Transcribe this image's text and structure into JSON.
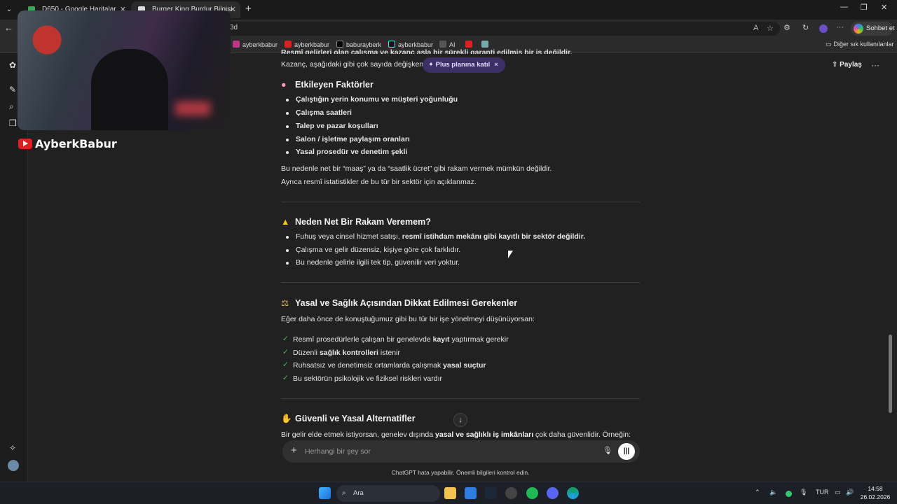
{
  "browser": {
    "tabs": [
      {
        "title": "D650 - Google Haritalar",
        "active": false
      },
      {
        "title": "Burger King Burdur Bilgisi",
        "active": true
      }
    ],
    "url_fragment": "3d",
    "sohbet_label": "Sohbet et",
    "bookmarks": [
      "ayberkbabur",
      "ayberkbabur",
      "baburayberk",
      "ayberkbabur",
      "AI"
    ],
    "other_bookmarks": "Diğer sık kullanılanlar"
  },
  "overlay": {
    "channel_name": "AyberkBabur"
  },
  "header": {
    "share_label": "Paylaş",
    "more_label": "···"
  },
  "promo": {
    "label": "Plus planına katıl",
    "close": "×"
  },
  "content": {
    "cut_top_line": "Resmî gelirleri olan çalışma ve kazanç asla bir sürekli garanti edilmiş bir iş değildir.",
    "intro_line_a": "Kazanç, aşağıdaki gibi çok sayıda değişkene",
    "section1": {
      "title": "Etkileyen Faktörler",
      "items": [
        "Çalıştığın yerin konumu ve müşteri yoğunluğu",
        "Çalışma saatleri",
        "Talep ve pazar koşulları",
        "Salon / işletme paylaşım oranları",
        "Yasal prosedür ve denetim şekli"
      ],
      "para1": "Bu nedenle net bir “maaş” ya da “saatlik ücret” gibi rakam vermek mümkün değildir.",
      "para2": "Ayrıca resmî istatistikler de bu tür bir sektör için açıklanmaz."
    },
    "section2": {
      "title": "Neden Net Bir Rakam Veremem?",
      "item1_pre": "Fuhuş veya cinsel hizmet satışı, ",
      "item1_bold": "resmî istihdam mekânı gibi kayıtlı bir sektör değildir.",
      "item2": "Çalışma ve gelir düzensiz, kişiye göre çok farklıdır.",
      "item3": "Bu nedenle gelirle ilgili tek tip, güvenilir veri yoktur."
    },
    "section3": {
      "title": "Yasal ve Sağlık Açısından Dikkat Edilmesi Gerekenler",
      "intro": "Eğer daha önce de konuştuğumuz gibi bu tür bir işe yönelmeyi düşünüyorsan:",
      "c1_pre": "Resmî prosedürlerle çalışan bir genelevde ",
      "c1_bold": "kayıt",
      "c1_post": " yaptırmak gerekir",
      "c2_pre": "Düzenli ",
      "c2_bold": "sağlık kontrolleri",
      "c2_post": " istenir",
      "c3_pre": "Ruhsatsız ve denetimsiz ortamlarda çalışmak ",
      "c3_bold": "yasal suçtur",
      "c4": "Bu sektörün psikolojik ve fiziksel riskleri vardır"
    },
    "section4": {
      "title": "Güvenli ve Yasal Alternatifler",
      "line_pre": "Bir gelir elde etmek istiyorsan, genelev dışında ",
      "line_bold": "yasal ve sağlıklı iş imkânları",
      "line_post": " çok daha güvenlidir. Örneğin:"
    }
  },
  "composer": {
    "placeholder": "Herhangi bir şey sor",
    "disclaimer": "ChatGPT hata yapabilir. Önemli bilgileri kontrol edin."
  },
  "taskbar": {
    "search_label": "Ara",
    "language": "TUR",
    "time": "14:58",
    "date": "26.02.2026"
  }
}
